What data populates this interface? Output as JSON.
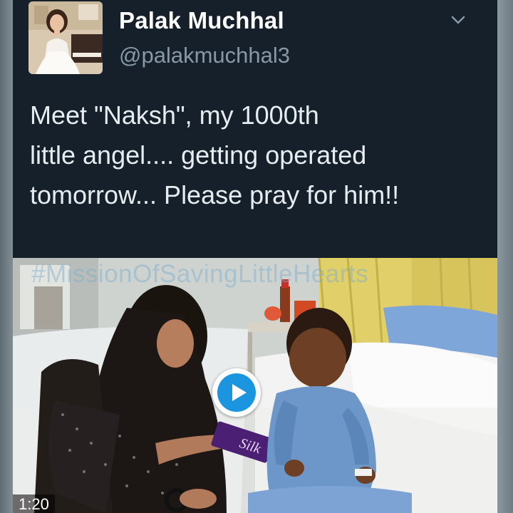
{
  "tweet": {
    "display_name": "Palak Muchhal",
    "handle": "@palakmuchhal3",
    "text_lines": [
      "Meet \"Naksh\", my 1000th",
      "little angel.... getting operated",
      "tomorrow... Please pray for him!!"
    ],
    "menu_icon": "chevron-down-icon",
    "avatar_icon": "profile-photo"
  },
  "media": {
    "watermark": "#MissionOfSavingLittleHearts",
    "duration": "1:20",
    "play_icon": "play-icon",
    "chocolate_text": "Silk"
  },
  "colors": {
    "background": "#15202b",
    "text": "#e6ecf0",
    "handle": "#8899a6",
    "play_accent": "#1b95e0"
  }
}
